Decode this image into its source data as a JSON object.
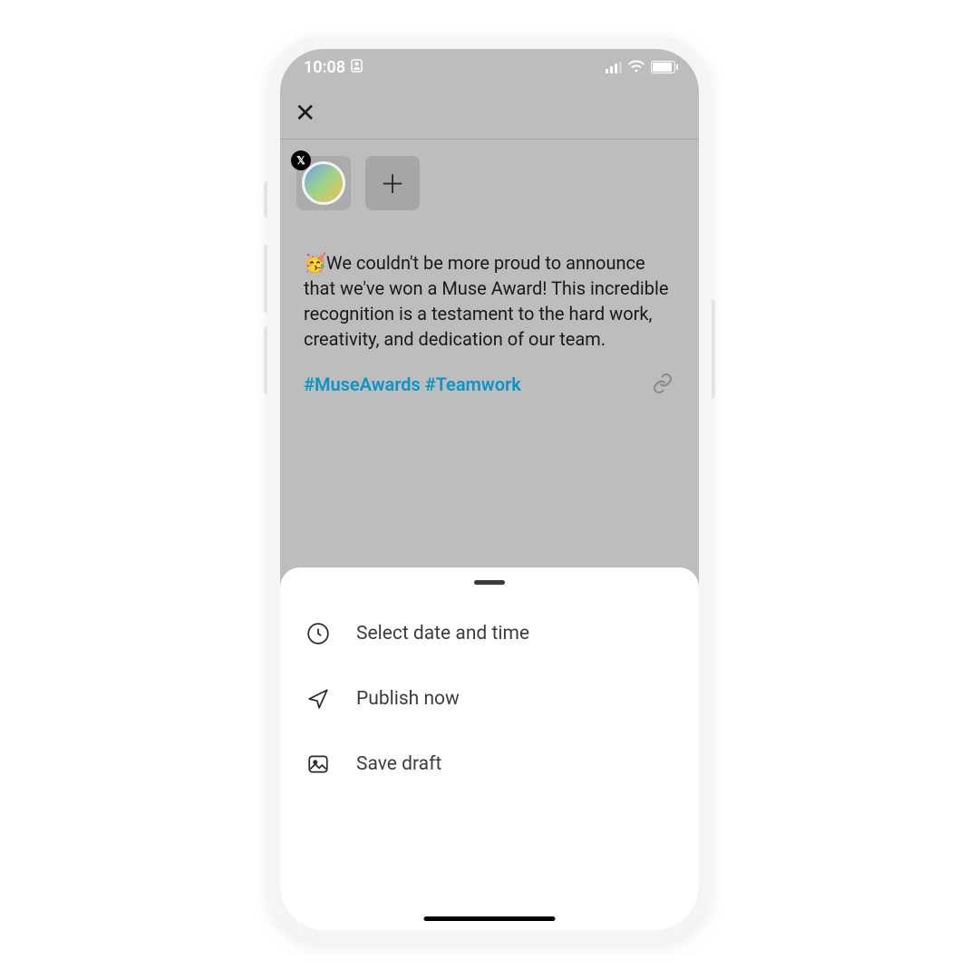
{
  "status": {
    "time": "10:08",
    "person_icon": "person-card-icon"
  },
  "topbar": {
    "close_label": "✕"
  },
  "accounts": {
    "badge": "𝕏",
    "add_label": "＋"
  },
  "composer": {
    "emoji": "🥳",
    "text": "We couldn't be more proud to announce that we've won a Muse Award! This incredible recognition is a testament to the hard work, creativity, and dedication of our team.",
    "hashtags": "#MuseAwards #Teamwork"
  },
  "sheet": {
    "items": [
      {
        "label": "Select date and time"
      },
      {
        "label": "Publish now"
      },
      {
        "label": "Save draft"
      }
    ]
  }
}
